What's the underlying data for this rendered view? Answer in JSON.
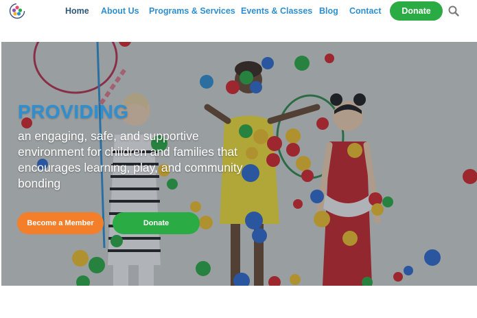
{
  "header": {
    "logo_icon": "flower-logo-icon",
    "nav": [
      {
        "label": "Home",
        "active": true
      },
      {
        "label": "About Us",
        "active": false
      },
      {
        "label": "Programs & Services",
        "active": false
      },
      {
        "label": "Events & Classes",
        "active": false
      },
      {
        "label": "Blog",
        "active": false
      },
      {
        "label": "Contact",
        "active": false
      }
    ],
    "donate_label": "Donate",
    "search_icon": "search-icon"
  },
  "hero": {
    "headline": "PROVIDING",
    "subtext": "an engaging, safe, and supportive environment for children and families that encourages learning, play, and community bonding",
    "primary_button": "Become a Member",
    "secondary_button": "Donate"
  },
  "colors": {
    "brand_blue": "#2e8fd0",
    "nav_active": "#2f5878",
    "donate_green": "#2bab43",
    "member_orange": "#f47f2b"
  }
}
